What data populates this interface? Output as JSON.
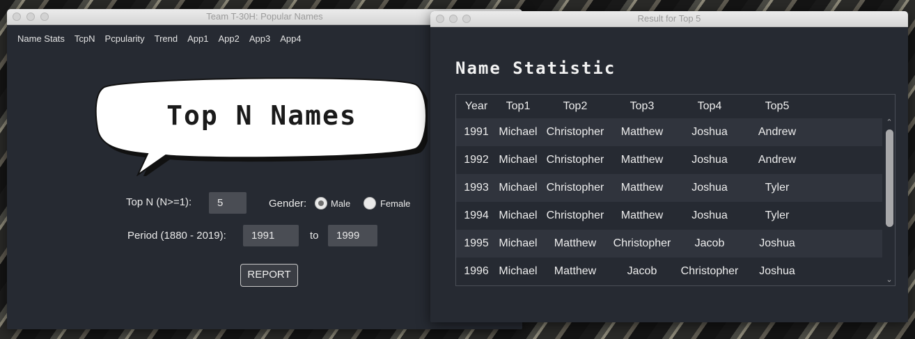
{
  "main_window": {
    "title": "Team T-30H: Popular Names",
    "menu": [
      "Name Stats",
      "TcpN",
      "Pcpularity",
      "Trend",
      "App1",
      "App2",
      "App3",
      "App4"
    ],
    "banner": "Top N Names",
    "topn_label": "Top N (N>=1):",
    "topn_value": "5",
    "gender_label": "Gender:",
    "gender_options": [
      "Male",
      "Female"
    ],
    "gender_selected": "Male",
    "period_label": "Period (1880 - 2019):",
    "period_from": "1991",
    "to_label": "to",
    "period_to": "1999",
    "report_button": "REPORT"
  },
  "result_window": {
    "title": "Result for Top 5",
    "heading": "Name Statistic",
    "columns": [
      "Year",
      "Top1",
      "Top2",
      "Top3",
      "Top4",
      "Top5"
    ],
    "rows": [
      [
        "1991",
        "Michael",
        "Christopher",
        "Matthew",
        "Joshua",
        "Andrew"
      ],
      [
        "1992",
        "Michael",
        "Christopher",
        "Matthew",
        "Joshua",
        "Andrew"
      ],
      [
        "1993",
        "Michael",
        "Christopher",
        "Matthew",
        "Joshua",
        "Tyler"
      ],
      [
        "1994",
        "Michael",
        "Christopher",
        "Matthew",
        "Joshua",
        "Tyler"
      ],
      [
        "1995",
        "Michael",
        "Matthew",
        "Christopher",
        "Jacob",
        "Joshua"
      ],
      [
        "1996",
        "Michael",
        "Matthew",
        "Jacob",
        "Christopher",
        "Joshua"
      ]
    ]
  }
}
